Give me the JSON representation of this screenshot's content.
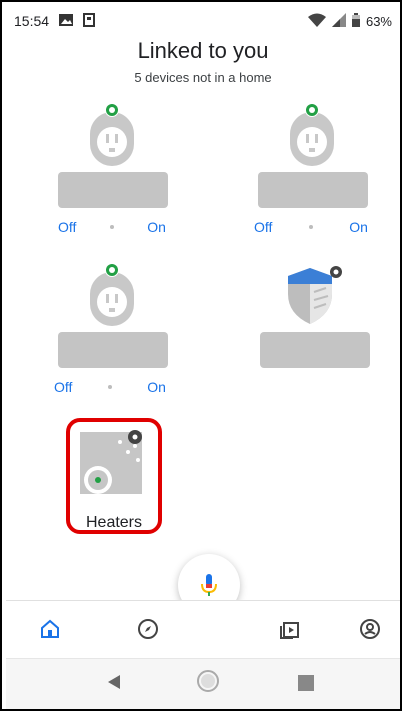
{
  "status_bar": {
    "time": "15:54",
    "battery": "63%"
  },
  "header": {
    "title": "Linked to you",
    "subtitle": "5 devices not in a home"
  },
  "devices": [
    {
      "type": "plug",
      "off_label": "Off",
      "on_label": "On"
    },
    {
      "type": "plug",
      "off_label": "Off",
      "on_label": "On"
    },
    {
      "type": "plug",
      "off_label": "Off",
      "on_label": "On"
    },
    {
      "type": "shield"
    },
    {
      "type": "heater",
      "label": "Heaters"
    }
  ],
  "colors": {
    "accent": "#1a73e8",
    "plug_body": "#c8c8c8",
    "plug_dot": "#22a045",
    "highlight": "#e00000",
    "placeholder": "#c4c4c4"
  },
  "bottom_nav": [
    {
      "icon": "home-icon"
    },
    {
      "icon": "compass-icon"
    },
    {
      "icon": "media-icon"
    },
    {
      "icon": "account-icon"
    }
  ]
}
